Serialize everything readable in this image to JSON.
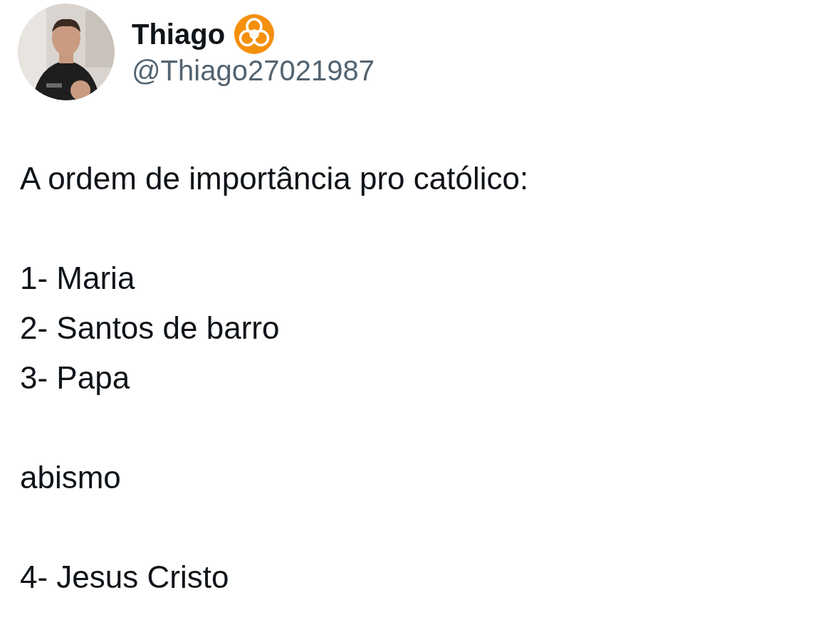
{
  "author": {
    "name": "Thiago",
    "handle": "@Thiago27021987"
  },
  "paragraphs": [
    [
      "A ordem de importância pro católico:"
    ],
    [
      "1- Maria",
      "2- Santos de barro",
      "3- Papa"
    ],
    [
      "abismo"
    ],
    [
      "4- Jesus Cristo"
    ]
  ]
}
